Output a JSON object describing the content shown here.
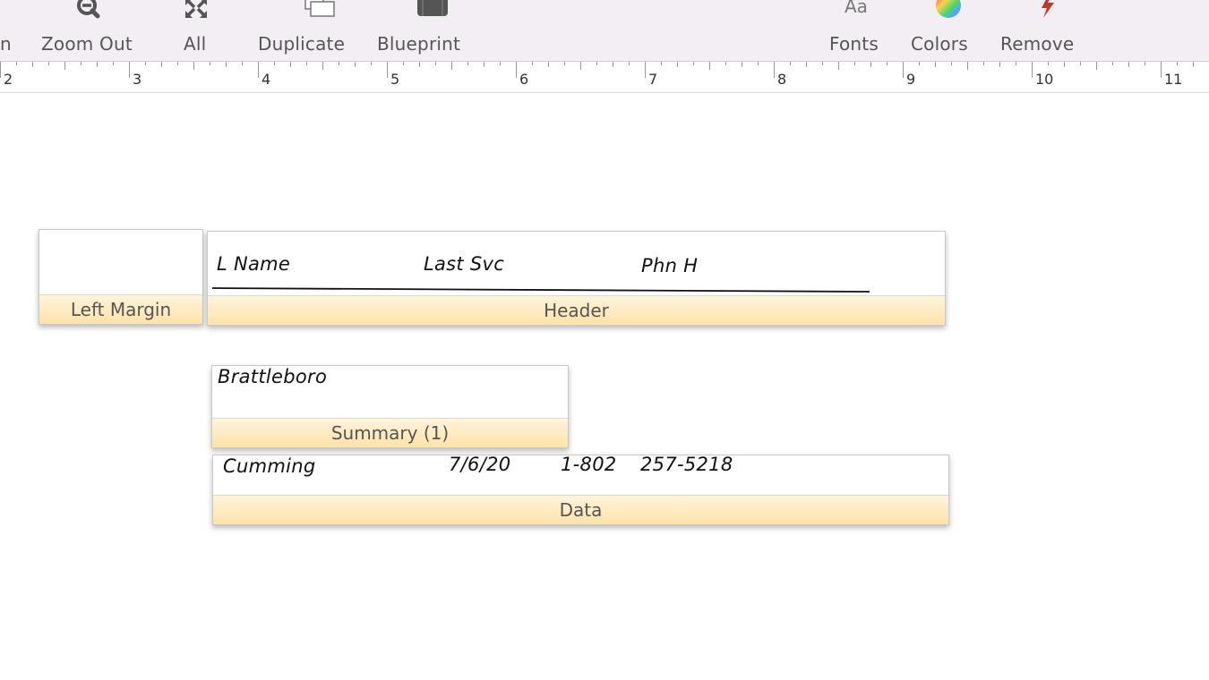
{
  "toolbar": {
    "items": [
      {
        "label": "n",
        "icon": "partial-icon"
      },
      {
        "label": "Zoom Out",
        "icon": "zoom-out-icon"
      },
      {
        "label": "All",
        "icon": "expand-arrows-icon"
      },
      {
        "label": "Duplicate",
        "icon": "duplicate-icon"
      },
      {
        "label": "Blueprint",
        "icon": "blueprint-icon"
      },
      {
        "label": "Fonts",
        "icon": "fonts-icon",
        "glyph": "Aa"
      },
      {
        "label": "Colors",
        "icon": "color-wheel-icon"
      },
      {
        "label": "Remove",
        "icon": "lightning-icon"
      }
    ]
  },
  "ruler": {
    "numbers": [
      "2",
      "3",
      "4",
      "5",
      "6",
      "7",
      "8",
      "9",
      "10",
      "11"
    ]
  },
  "parts": {
    "left_margin": {
      "label": "Left Margin"
    },
    "header": {
      "label": "Header",
      "fields": [
        "L Name",
        "Last Svc",
        "Phn H"
      ]
    },
    "summary": {
      "label": "Summary (1)",
      "fields": [
        "Brattleboro"
      ]
    },
    "data": {
      "label": "Data",
      "fields": [
        "Cumming",
        "7/6/20",
        "1-802",
        "257-5218"
      ]
    }
  },
  "colors": {
    "toolbar_bg": "#f3eef3",
    "band_top": "#fff4dd",
    "band_bottom": "#ffe2a8",
    "remove_accent": "#c0392b"
  }
}
